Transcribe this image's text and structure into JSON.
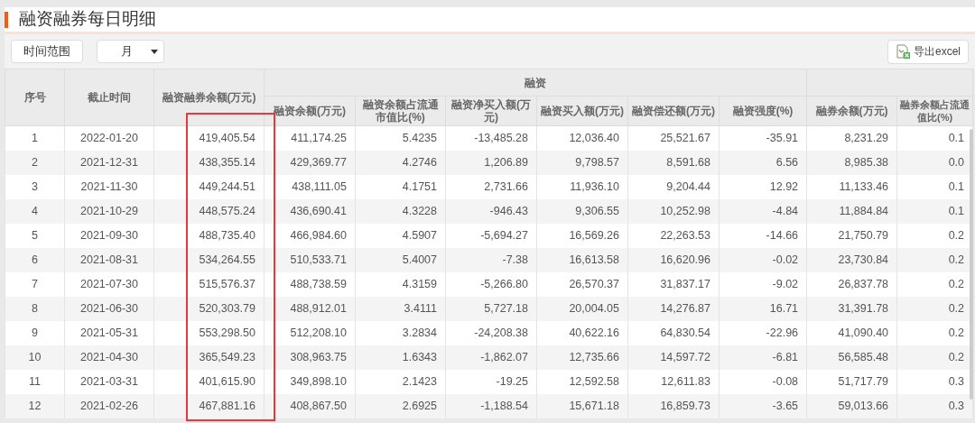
{
  "title": "融资融券每日明细",
  "toolbar": {
    "range_label": "时间范围",
    "period": {
      "value": "月"
    },
    "export_button": "导出excel"
  },
  "table": {
    "columns": [
      {
        "label": "序号",
        "highlighted": false
      },
      {
        "label": "截止时间",
        "highlighted": false
      },
      {
        "label": "融资融券余额(万元)",
        "highlighted": true
      },
      {
        "label": "融资",
        "colspan": 6,
        "children": [
          {
            "label": "融资余额(万元)"
          },
          {
            "label": "融资余额占流通市值比(%)"
          },
          {
            "label": "融资净买入额(万元)"
          },
          {
            "label": "融资买入额(万元)"
          },
          {
            "label": "融资偿还额(万元)"
          },
          {
            "label": "融资强度(%)"
          }
        ]
      },
      {
        "label": "融券余额(万元)",
        "kind": "under_blank"
      },
      {
        "label": "融券余额占流通值比(%)",
        "kind": "under_blank"
      }
    ],
    "rows": [
      [
        "1",
        "2022-01-20",
        "419,405.54",
        "411,174.25",
        "5.4235",
        "-13,485.28",
        "12,036.40",
        "25,521.67",
        "-35.91",
        "8,231.29",
        "0.1"
      ],
      [
        "2",
        "2021-12-31",
        "438,355.14",
        "429,369.77",
        "4.2746",
        "1,206.89",
        "9,798.57",
        "8,591.68",
        "6.56",
        "8,985.38",
        "0.0"
      ],
      [
        "3",
        "2021-11-30",
        "449,244.51",
        "438,111.05",
        "4.1751",
        "2,731.66",
        "11,936.10",
        "9,204.44",
        "12.92",
        "11,133.46",
        "0.1"
      ],
      [
        "4",
        "2021-10-29",
        "448,575.24",
        "436,690.41",
        "4.3228",
        "-946.43",
        "9,306.55",
        "10,252.98",
        "-4.84",
        "11,884.84",
        "0.1"
      ],
      [
        "5",
        "2021-09-30",
        "488,735.40",
        "466,984.60",
        "4.5907",
        "-5,694.27",
        "16,569.26",
        "22,263.53",
        "-14.66",
        "21,750.79",
        "0.2"
      ],
      [
        "6",
        "2021-08-31",
        "534,264.55",
        "510,533.71",
        "5.4007",
        "-7.38",
        "16,613.58",
        "16,620.96",
        "-0.02",
        "23,730.84",
        "0.2"
      ],
      [
        "7",
        "2021-07-30",
        "515,576.37",
        "488,738.59",
        "4.3159",
        "-5,266.80",
        "26,570.37",
        "31,837.17",
        "-9.02",
        "26,837.78",
        "0.2"
      ],
      [
        "8",
        "2021-06-30",
        "520,303.79",
        "488,912.01",
        "3.4111",
        "5,727.18",
        "20,004.05",
        "14,276.87",
        "16.71",
        "31,391.78",
        "0.2"
      ],
      [
        "9",
        "2021-05-31",
        "553,298.50",
        "512,208.10",
        "3.2834",
        "-24,208.38",
        "40,622.16",
        "64,830.54",
        "-22.96",
        "41,090.40",
        "0.2"
      ],
      [
        "10",
        "2021-04-30",
        "365,549.23",
        "308,963.75",
        "1.6343",
        "-1,862.07",
        "12,735.66",
        "14,597.72",
        "-6.81",
        "56,585.48",
        "0.2"
      ],
      [
        "11",
        "2021-03-31",
        "401,615.90",
        "349,898.10",
        "2.1423",
        "-19.25",
        "12,592.58",
        "12,611.83",
        "-0.08",
        "51,717.79",
        "0.3"
      ],
      [
        "12",
        "2021-02-26",
        "467,881.16",
        "408,867.50",
        "2.6925",
        "-1,188.54",
        "15,671.18",
        "16,859.73",
        "-3.65",
        "59,013.66",
        "0.3"
      ]
    ]
  }
}
